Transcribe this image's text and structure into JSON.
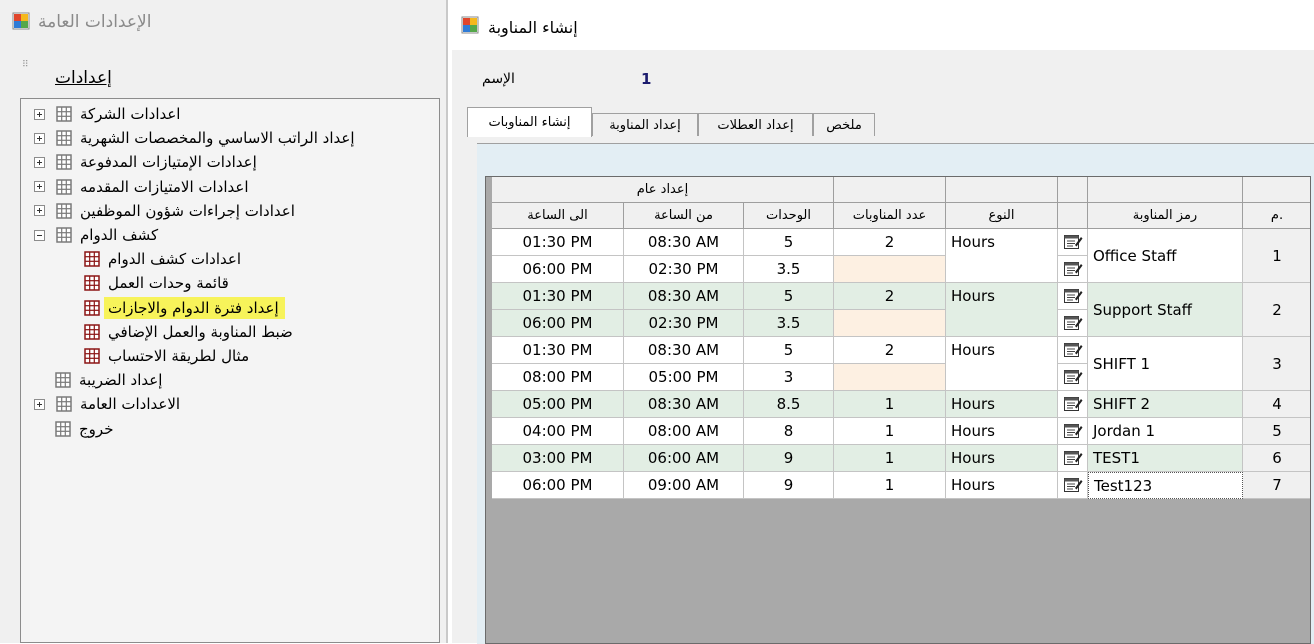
{
  "left_window": {
    "title": "الإعدادات العامة",
    "heading": "إعدادات",
    "grip": "⠿",
    "tree": [
      {
        "label": "اعدادات الشركة",
        "expander": "plus"
      },
      {
        "label": "إعداد الراتب الاساسي والمخصصات الشهرية",
        "expander": "plus"
      },
      {
        "label": "إعدادات الإمتيازات المدفوعة",
        "expander": "plus"
      },
      {
        "label": "اعدادات الامتيازات المقدمه",
        "expander": "plus"
      },
      {
        "label": "اعدادات إجراءات شؤون الموظفين",
        "expander": "plus"
      },
      {
        "label": "كشف الدوام",
        "expander": "minus"
      },
      {
        "label": "اعدادات كشف الدوام",
        "child": true
      },
      {
        "label": "قائمة وحدات العمل",
        "child": true
      },
      {
        "label": "إعداد فترة الدوام والاجازات",
        "child": true,
        "selected": true
      },
      {
        "label": "ضبط المناوبة والعمل الإضافي",
        "child": true
      },
      {
        "label": "مثال لطريقة الاحتساب",
        "child": true
      },
      {
        "label": "إعداد الضريبة"
      },
      {
        "label": "الاعدادات العامة",
        "expander": "plus"
      },
      {
        "label": "خروج"
      }
    ]
  },
  "right_window": {
    "title": "إنشاء المناوبة",
    "name_label": "الإسم",
    "name_value": "1",
    "tabs": [
      "إنشاء المناوبات",
      "إعداد المناوبة",
      "إعداد العطلات",
      "ملخص"
    ],
    "active_tab": 0,
    "grid": {
      "group_header": "إعداد عام",
      "columns": [
        "م.",
        "رمز المناوبة",
        "",
        "النوع",
        "عدد المناوبات",
        "الوحدات",
        "من الساعة",
        "الى الساعة"
      ],
      "rows": [
        {
          "no": "1",
          "code": "Office Staff",
          "type": "Hours",
          "count": "2",
          "color": "white",
          "subs": [
            {
              "units": "5",
              "from": "08:30 AM",
              "to": "01:30 PM"
            },
            {
              "units": "3.5",
              "from": "02:30 PM",
              "to": "06:00 PM"
            }
          ]
        },
        {
          "no": "2",
          "code": "Support Staff",
          "type": "Hours",
          "count": "2",
          "color": "green",
          "subs": [
            {
              "units": "5",
              "from": "08:30 AM",
              "to": "01:30 PM"
            },
            {
              "units": "3.5",
              "from": "02:30 PM",
              "to": "06:00 PM"
            }
          ]
        },
        {
          "no": "3",
          "code": "SHIFT 1",
          "type": "Hours",
          "count": "2",
          "color": "white",
          "subs": [
            {
              "units": "5",
              "from": "08:30 AM",
              "to": "01:30 PM"
            },
            {
              "units": "3",
              "from": "05:00 PM",
              "to": "08:00 PM"
            }
          ]
        },
        {
          "no": "4",
          "code": "SHIFT 2",
          "type": "Hours",
          "count": "1",
          "color": "green",
          "subs": [
            {
              "units": "8.5",
              "from": "08:30 AM",
              "to": "05:00 PM"
            }
          ]
        },
        {
          "no": "5",
          "code": "Jordan 1",
          "type": "Hours",
          "count": "1",
          "color": "white",
          "subs": [
            {
              "units": "8",
              "from": "08:00 AM",
              "to": "04:00 PM"
            }
          ]
        },
        {
          "no": "6",
          "code": "TEST1",
          "type": "Hours",
          "count": "1",
          "color": "green",
          "subs": [
            {
              "units": "9",
              "from": "06:00 AM",
              "to": "03:00 PM"
            }
          ]
        },
        {
          "no": "7",
          "code": "Test123",
          "type": "Hours",
          "count": "1",
          "color": "white",
          "editing": true,
          "subs": [
            {
              "units": "9",
              "from": "09:00 AM",
              "to": "06:00 PM"
            }
          ]
        }
      ]
    }
  },
  "colors": {
    "row_white": "#ffffff",
    "row_green": "#e2eee4",
    "empty_count_cell": "#fdf0e2",
    "highlight": "#f7f35a"
  },
  "icons": {
    "window": "app-window-icon",
    "tree_node": "grid-node-icon",
    "edit": "edit-form-icon"
  }
}
